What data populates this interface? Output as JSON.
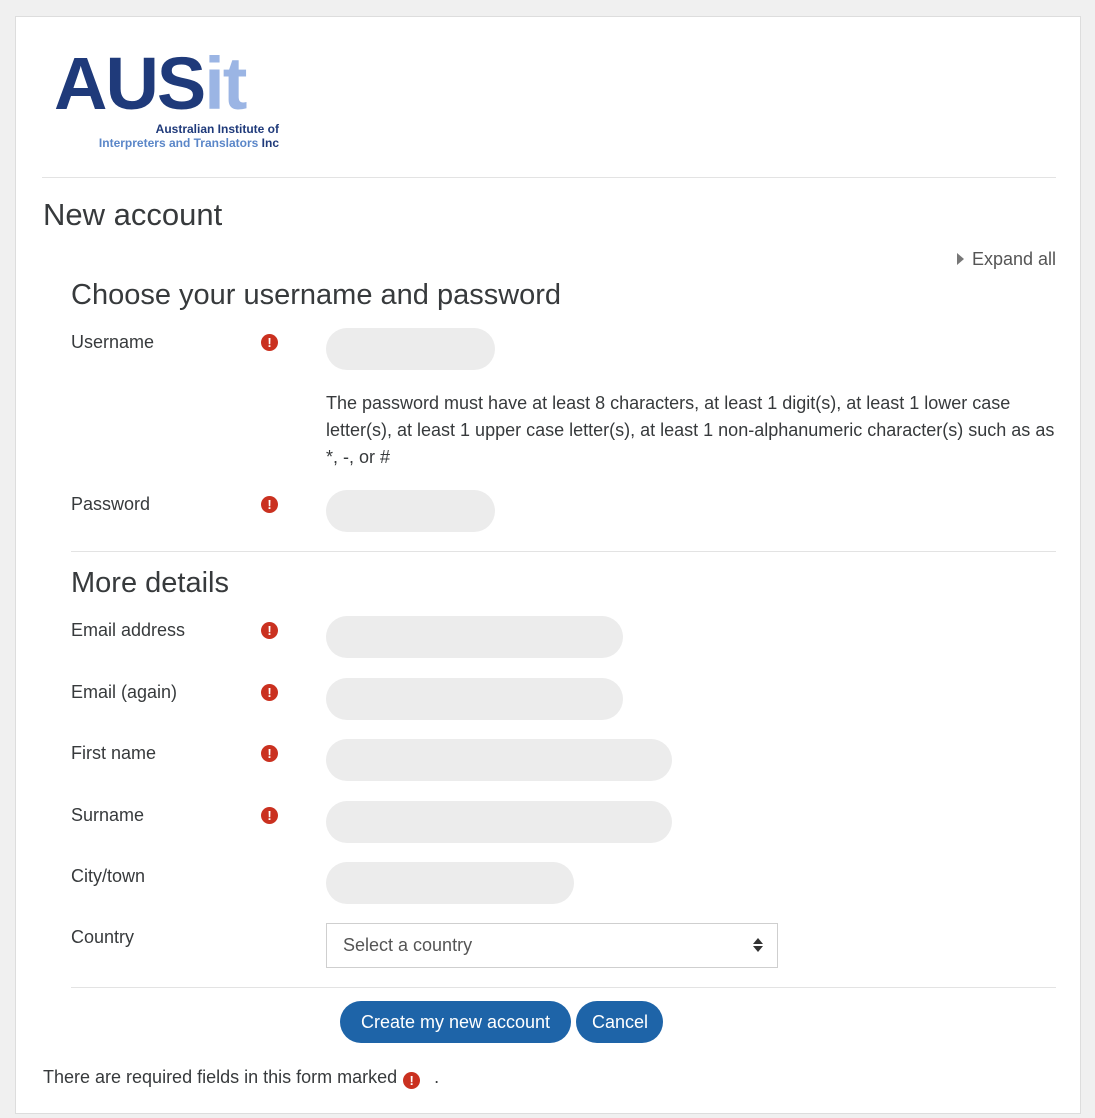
{
  "logo": {
    "word_dark": "AUS",
    "word_light": "it",
    "tagline_1": "Australian Institute of",
    "tagline_2": "Interpreters and Translators",
    "tagline_inc": "Inc",
    "colors": {
      "dark": "#1f3a7a",
      "light": "#9bb5e4"
    }
  },
  "page_title": "New account",
  "expand_all": "Expand all",
  "sections": {
    "credentials": {
      "title": "Choose your username and password",
      "username_label": "Username",
      "password_help": "The password must have at least 8 characters, at least 1 digit(s), at least 1 lower case letter(s), at least 1 upper case letter(s), at least 1 non-alphanumeric character(s) such as as *, -, or #",
      "password_label": "Password"
    },
    "details": {
      "title": "More details",
      "email_label": "Email address",
      "email_again_label": "Email (again)",
      "firstname_label": "First name",
      "surname_label": "Surname",
      "city_label": "City/town",
      "country_label": "Country",
      "country_selected": "Select a country"
    }
  },
  "required_icon": "!",
  "buttons": {
    "create": "Create my new account",
    "cancel": "Cancel"
  },
  "footer": {
    "note": "There are required fields in this form marked",
    "period": "."
  },
  "colors": {
    "accent": "#1e64a8",
    "required": "#ca3120",
    "field_bg": "#ececec"
  }
}
